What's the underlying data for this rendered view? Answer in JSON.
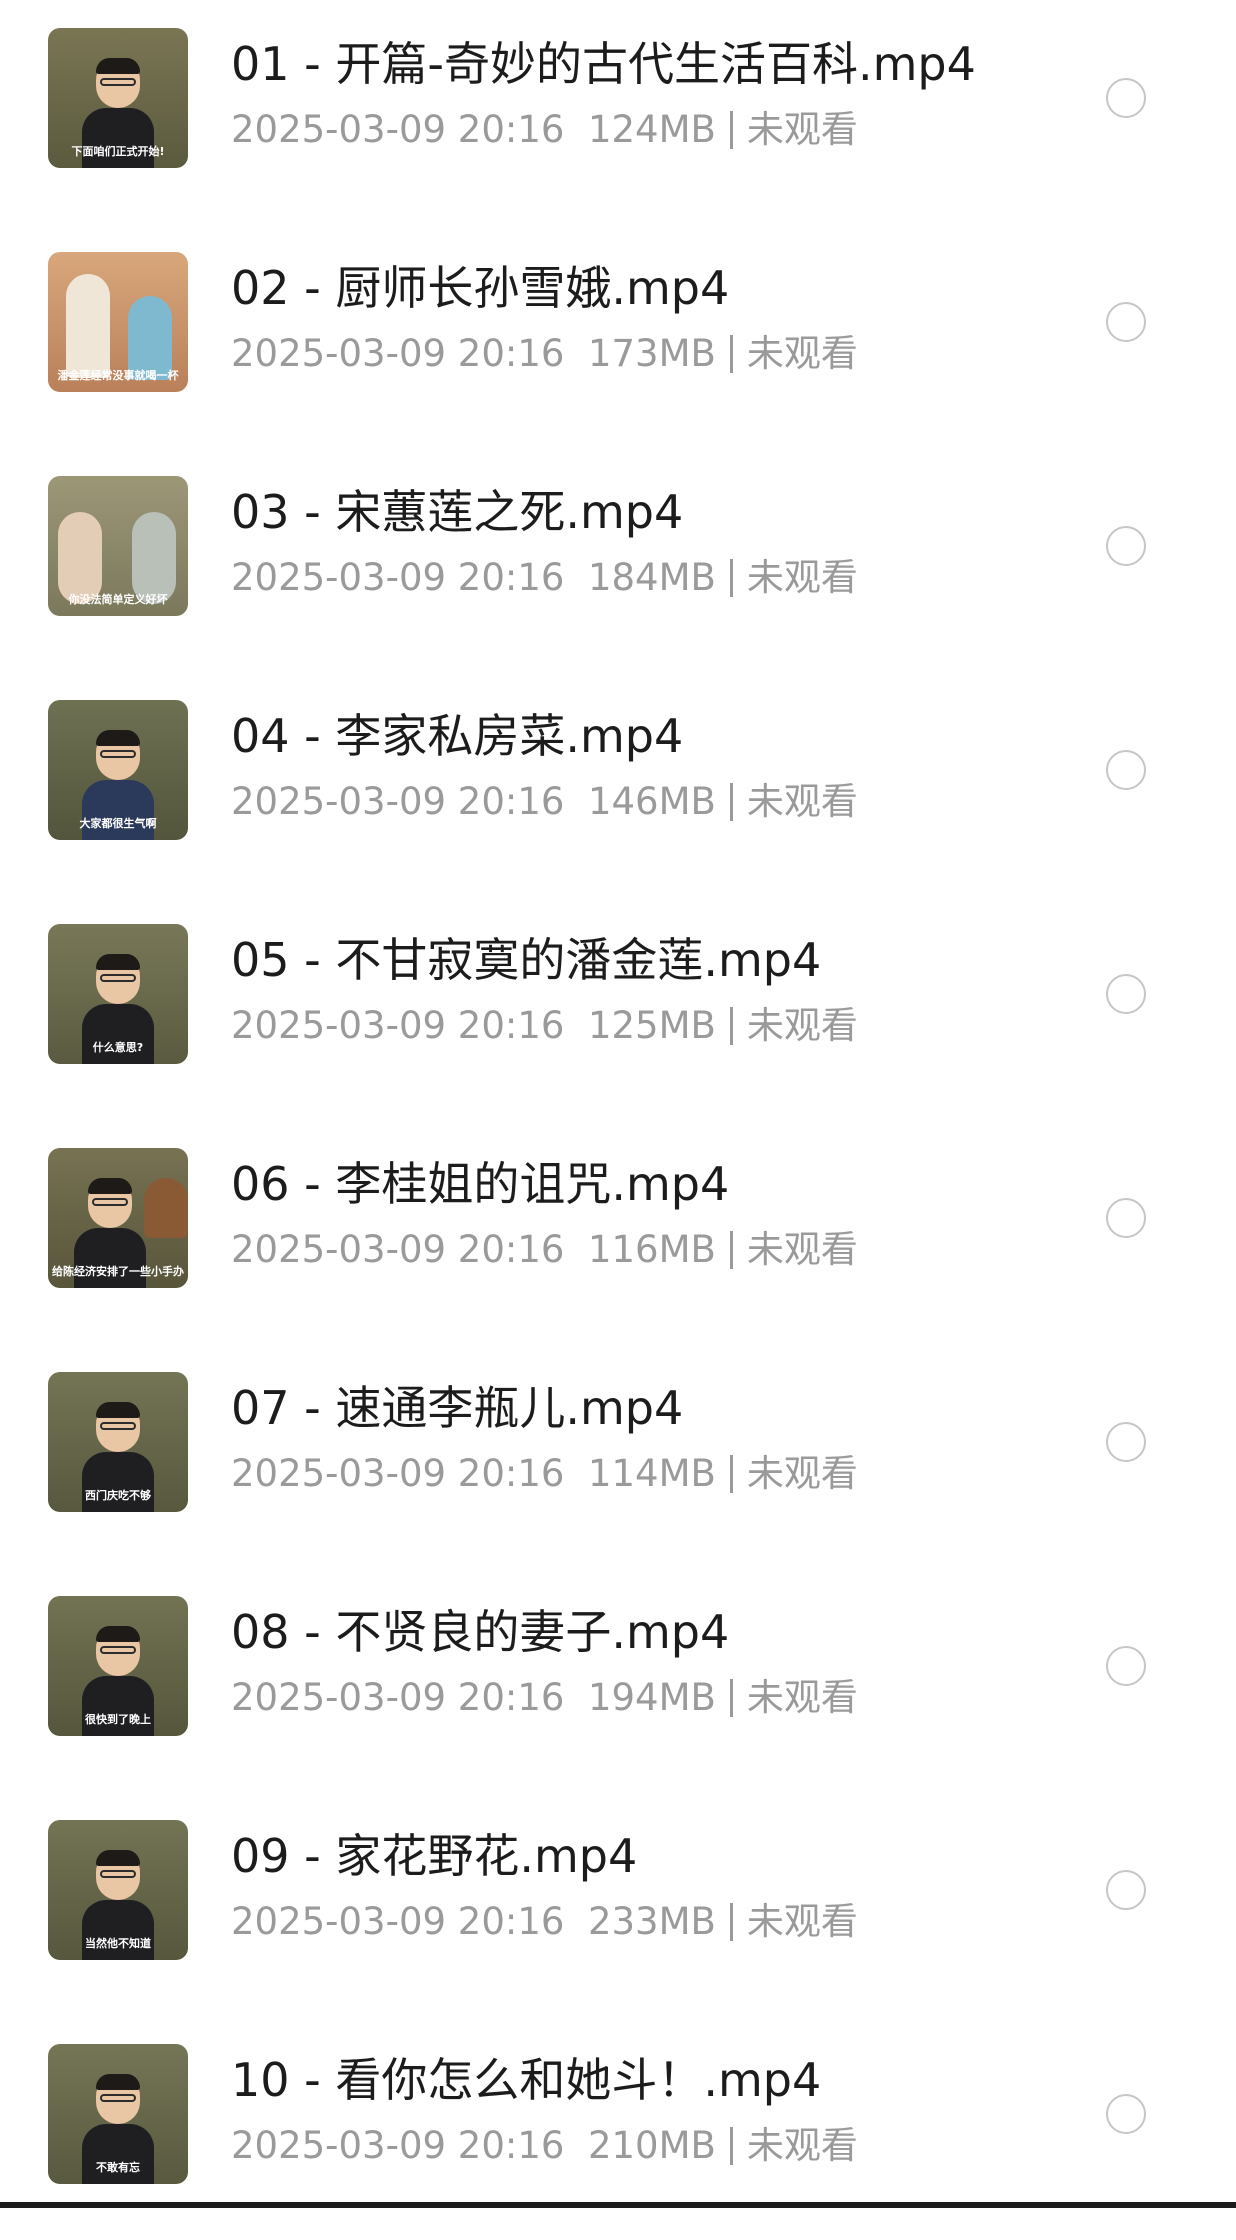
{
  "files": [
    {
      "title": "01 - 开篇-奇妙的古代生活百科.mp4",
      "date": "2025-03-09 20:16",
      "size": "124MB",
      "status": "未观看",
      "thumb_caption": "下面咱们正式开始!",
      "thumb_bg": "#6b6a4a"
    },
    {
      "title": "02 - 厨师长孙雪娥.mp4",
      "date": "2025-03-09 20:16",
      "size": "173MB",
      "status": "未观看",
      "thumb_caption": "潘金莲经常没事就喝一杯",
      "thumb_bg": "#c7936a"
    },
    {
      "title": "03 - 宋蕙莲之死.mp4",
      "date": "2025-03-09 20:16",
      "size": "184MB",
      "status": "未观看",
      "thumb_caption": "你没法简单定义好坏",
      "thumb_bg": "#8d8a6b"
    },
    {
      "title": "04 - 李家私房菜.mp4",
      "date": "2025-03-09 20:16",
      "size": "146MB",
      "status": "未观看",
      "thumb_caption": "大家都很生气啊",
      "thumb_bg": "#64674c"
    },
    {
      "title": "05 - 不甘寂寞的潘金莲.mp4",
      "date": "2025-03-09 20:16",
      "size": "125MB",
      "status": "未观看",
      "thumb_caption": "什么意思?",
      "thumb_bg": "#6e6e4e"
    },
    {
      "title": "06 - 李桂姐的诅咒.mp4",
      "date": "2025-03-09 20:16",
      "size": "116MB",
      "status": "未观看",
      "thumb_caption": "给陈经济安排了一些小手办",
      "thumb_bg": "#6c6848"
    },
    {
      "title": "07 - 速通李瓶儿.mp4",
      "date": "2025-03-09 20:16",
      "size": "114MB",
      "status": "未观看",
      "thumb_caption": "西门庆吃不够",
      "thumb_bg": "#6a6a4c"
    },
    {
      "title": "08 - 不贤良的妻子.mp4",
      "date": "2025-03-09 20:16",
      "size": "194MB",
      "status": "未观看",
      "thumb_caption": "很快到了晚上",
      "thumb_bg": "#676848"
    },
    {
      "title": "09 - 家花野花.mp4",
      "date": "2025-03-09 20:16",
      "size": "233MB",
      "status": "未观看",
      "thumb_caption": "当然他不知道",
      "thumb_bg": "#686a4a"
    },
    {
      "title": "10 - 看你怎么和她斗！.mp4",
      "date": "2025-03-09 20:16",
      "size": "210MB",
      "status": "未观看",
      "thumb_caption": "不敢有忘",
      "thumb_bg": "#6a6a4c"
    }
  ]
}
